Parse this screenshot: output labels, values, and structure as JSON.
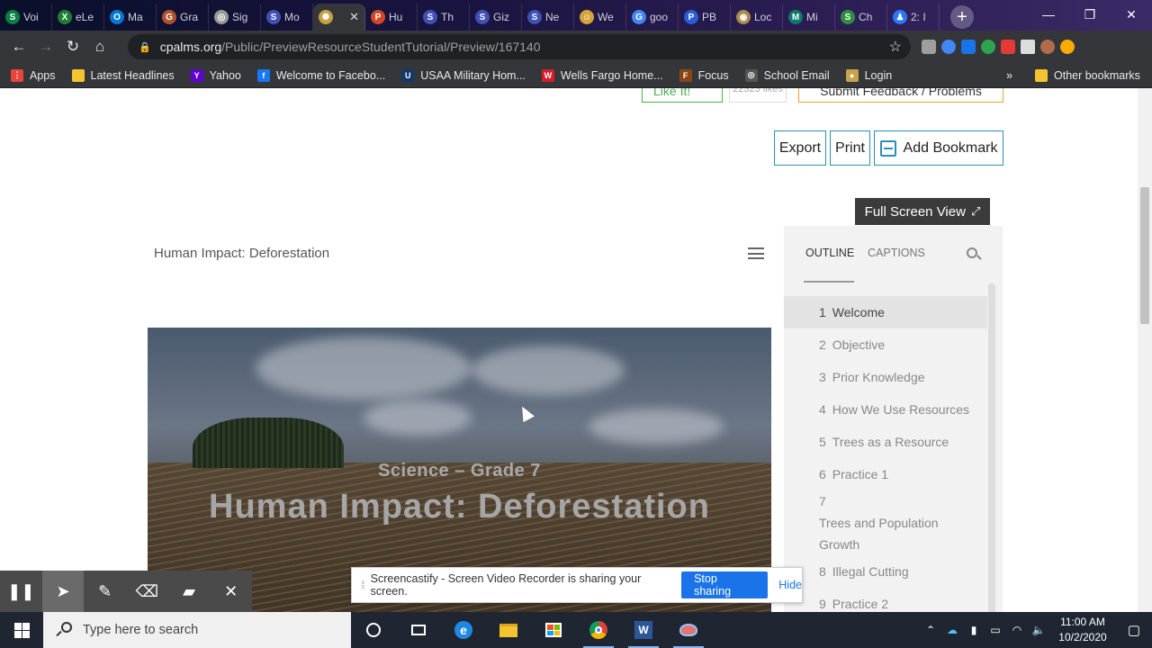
{
  "browser": {
    "tabs": [
      {
        "label": "Voi",
        "color": "#0b8043",
        "glyph": "S"
      },
      {
        "label": "eLe",
        "color": "#1e7e34",
        "glyph": "X"
      },
      {
        "label": "Ma",
        "color": "#0078d4",
        "glyph": "O"
      },
      {
        "label": "Gra",
        "color": "#b0522b",
        "glyph": "G"
      },
      {
        "label": "Sig",
        "color": "#999999",
        "glyph": "◎"
      },
      {
        "label": "Mo",
        "color": "#3f51b5",
        "glyph": "S"
      },
      {
        "label": "",
        "color": "#c8a040",
        "glyph": "✺",
        "active": true
      },
      {
        "label": "Hu",
        "color": "#d24726",
        "glyph": "P"
      },
      {
        "label": "Th",
        "color": "#3f51b5",
        "glyph": "S"
      },
      {
        "label": "Giz",
        "color": "#3f51b5",
        "glyph": "S"
      },
      {
        "label": "Ne",
        "color": "#3f51b5",
        "glyph": "S"
      },
      {
        "label": "We",
        "color": "#d4a43a",
        "glyph": "☺"
      },
      {
        "label": "goo",
        "color": "#4285f4",
        "glyph": "G"
      },
      {
        "label": "PB",
        "color": "#2b5bd7",
        "glyph": "P"
      },
      {
        "label": "Loc",
        "color": "#a88c4a",
        "glyph": "◉"
      },
      {
        "label": "Mi",
        "color": "#0a7a6a",
        "glyph": "M"
      },
      {
        "label": "Ch",
        "color": "#2f8f3a",
        "glyph": "S"
      },
      {
        "label": "2: I",
        "color": "#2979ff",
        "glyph": "♟"
      }
    ],
    "url_host": "cpalms.org",
    "url_path": "/Public/PreviewResourceStudentTutorial/Preview/167140",
    "bookmarks": [
      {
        "label": "Apps",
        "color": "#e8453c",
        "glyph": "⋮"
      },
      {
        "label": "Latest Headlines",
        "color": "#f4c430",
        "glyph": ""
      },
      {
        "label": "Yahoo",
        "color": "#6001d2",
        "glyph": "Y"
      },
      {
        "label": "Welcome to Facebo...",
        "color": "#1877f2",
        "glyph": "f"
      },
      {
        "label": "USAA Military Hom...",
        "color": "#12386b",
        "glyph": "U"
      },
      {
        "label": "Wells Fargo Home...",
        "color": "#d71e28",
        "glyph": "W"
      },
      {
        "label": "Focus",
        "color": "#8b4513",
        "glyph": "F"
      },
      {
        "label": "School Email",
        "color": "#555555",
        "glyph": "◎"
      },
      {
        "label": "Login",
        "color": "#c9a34a",
        "glyph": "●"
      }
    ],
    "bookmarks_overflow": "»",
    "other_bookmarks": "Other bookmarks"
  },
  "page": {
    "like_label": "Like It!",
    "like_count": "22323 likes",
    "feedback_label": "Submit Feedback / Problems",
    "export_label": "Export",
    "print_label": "Print",
    "bookmark_label": "Add Bookmark",
    "fullscreen_label": "Full Screen View",
    "player_title": "Human Impact: Deforestation",
    "slide_subtitle": "Science – Grade 7",
    "slide_title": "Human Impact: Deforestation",
    "outline_tab": "OUTLINE",
    "captions_tab": "CAPTIONS",
    "outline": [
      {
        "num": "1",
        "label": "Welcome",
        "selected": true
      },
      {
        "num": "2",
        "label": "Objective"
      },
      {
        "num": "3",
        "label": "Prior Knowledge"
      },
      {
        "num": "4",
        "label": "How We Use Resources"
      },
      {
        "num": "5",
        "label": "Trees as a Resource"
      },
      {
        "num": "6",
        "label": "Practice 1"
      },
      {
        "num": "7",
        "label": "Trees and Population Growth"
      },
      {
        "num": "8",
        "label": "Illegal Cutting"
      },
      {
        "num": "9",
        "label": "Practice 2"
      }
    ]
  },
  "screencast": {
    "share_text": "Screencastify - Screen Video Recorder is sharing your screen.",
    "stop_label": "Stop sharing",
    "hide_label": "Hide"
  },
  "taskbar": {
    "search_placeholder": "Type here to search",
    "time": "11:00 AM",
    "date": "10/2/2020"
  }
}
